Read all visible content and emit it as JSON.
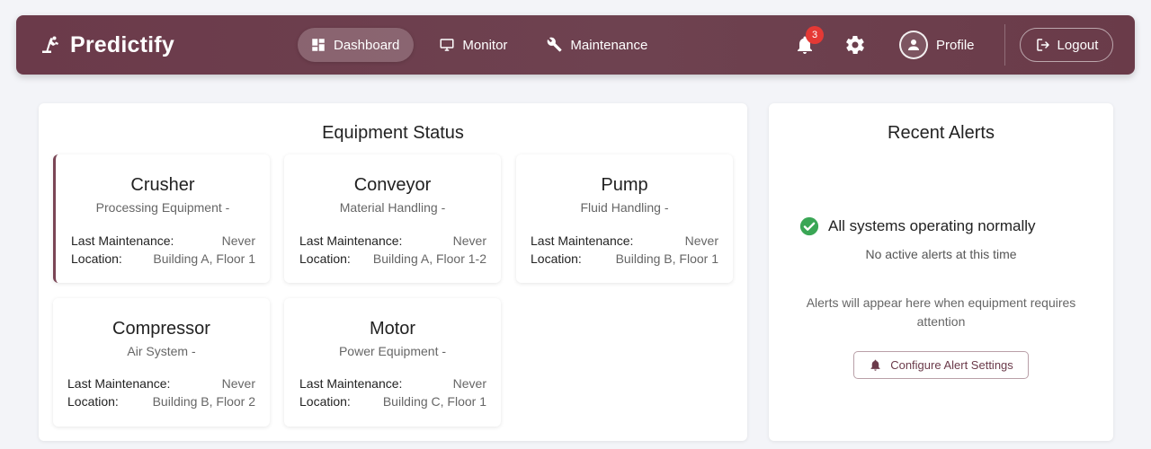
{
  "navbar": {
    "brand": "Predictify",
    "links": [
      {
        "label": "Dashboard",
        "icon": "dashboard-icon",
        "active": true
      },
      {
        "label": "Monitor",
        "icon": "monitor-icon",
        "active": false
      },
      {
        "label": "Maintenance",
        "icon": "wrench-icon",
        "active": false
      }
    ],
    "notification_count": "3",
    "profile_label": "Profile",
    "logout_label": "Logout"
  },
  "equipment": {
    "title": "Equipment Status",
    "last_maintenance_label": "Last Maintenance:",
    "location_label": "Location:",
    "items": [
      {
        "name": "Crusher",
        "type": "Processing Equipment -",
        "last_maintenance": "Never",
        "location": "Building A, Floor 1"
      },
      {
        "name": "Conveyor",
        "type": "Material Handling -",
        "last_maintenance": "Never",
        "location": "Building A, Floor 1-2"
      },
      {
        "name": "Pump",
        "type": "Fluid Handling -",
        "last_maintenance": "Never",
        "location": "Building B, Floor 1"
      },
      {
        "name": "Compressor",
        "type": "Air System -",
        "last_maintenance": "Never",
        "location": "Building B, Floor 2"
      },
      {
        "name": "Motor",
        "type": "Power Equipment -",
        "last_maintenance": "Never",
        "location": "Building C, Floor 1"
      }
    ]
  },
  "alerts": {
    "title": "Recent Alerts",
    "status": "All systems operating normally",
    "status_sub": "No active alerts at this time",
    "info": "Alerts will appear here when equipment requires attention",
    "config_button": "Configure Alert Settings"
  },
  "colors": {
    "navbar": "#6b3a4a",
    "accent": "#7a4555",
    "success": "#3aa655",
    "badge": "#e53935"
  }
}
